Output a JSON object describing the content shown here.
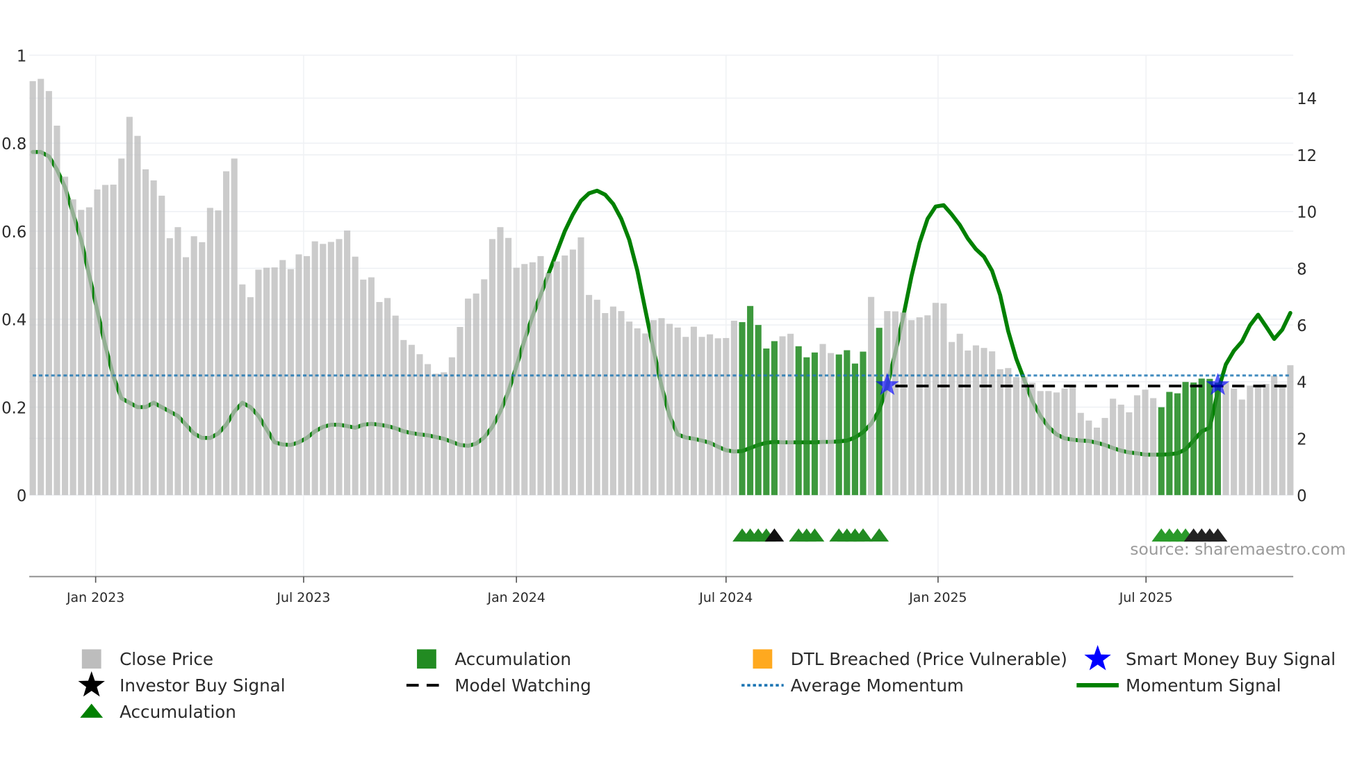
{
  "chart_data": {
    "type": "bar",
    "title": "",
    "source": "source: sharemaestro.com",
    "left_axis": {
      "range": [
        0,
        1
      ],
      "ticks": [
        "0",
        "0.2",
        "0.4",
        "0.6",
        "0.8",
        "1"
      ],
      "tick_values": [
        0,
        0.2,
        0.4,
        0.6,
        0.8,
        1
      ]
    },
    "right_axis": {
      "range": [
        0,
        14
      ],
      "ticks": [
        "0",
        "2",
        "4",
        "6",
        "8",
        "10",
        "12",
        "14"
      ],
      "tick_values": [
        0,
        2,
        4,
        6,
        8,
        10,
        12,
        14
      ]
    },
    "x_axis": {
      "unit": "weekly bar number (1 = first bar)",
      "ticks": [
        {
          "label": "Jan 2023",
          "bar": 8.8
        },
        {
          "label": "Jul 2023",
          "bar": 34.6
        },
        {
          "label": "Jan 2024",
          "bar": 61.0
        },
        {
          "label": "Jul 2024",
          "bar": 87.0
        },
        {
          "label": "Jan 2025",
          "bar": 113.3
        },
        {
          "label": "Jul 2025",
          "bar": 139.1
        }
      ]
    },
    "close_price": [
      14.6,
      14.68,
      14.25,
      13.03,
      11.23,
      10.43,
      10.06,
      10.15,
      10.78,
      10.94,
      10.95,
      11.87,
      13.34,
      12.67,
      11.49,
      11.1,
      10.56,
      9.06,
      9.45,
      8.39,
      9.13,
      8.92,
      10.13,
      10.04,
      11.42,
      11.87,
      7.43,
      6.98,
      7.95,
      8.02,
      8.03,
      8.29,
      7.97,
      8.49,
      8.43,
      8.95,
      8.86,
      8.93,
      9.03,
      9.33,
      8.41,
      7.6,
      7.68,
      6.81,
      6.95,
      6.33,
      5.47,
      5.3,
      4.97,
      4.62,
      4.28,
      4.33,
      4.86,
      5.93,
      6.93,
      7.11,
      7.61,
      9.03,
      9.45,
      9.07,
      8.02,
      8.15,
      8.21,
      8.43,
      7.83,
      8.24,
      8.45,
      8.66,
      9.09,
      7.06,
      6.89,
      6.42,
      6.65,
      6.49,
      6.12,
      5.88,
      5.7,
      6.17,
      6.24,
      6.04,
      5.91,
      5.58,
      5.94,
      5.58,
      5.67,
      5.53,
      5.54,
      6.15,
      6.1,
      6.67,
      6.0,
      5.17,
      5.43,
      5.6,
      5.69,
      5.25,
      4.86,
      5.03,
      5.33,
      5.01,
      4.96,
      5.11,
      4.64,
      5.06,
      6.99,
      5.9,
      6.49,
      6.48,
      6.44,
      6.17,
      6.27,
      6.34,
      6.78,
      6.76,
      5.4,
      5.69,
      5.1,
      5.28,
      5.19,
      5.07,
      4.44,
      4.48,
      4.16,
      4.16,
      3.96,
      3.67,
      3.67,
      3.62,
      3.76,
      3.83,
      2.9,
      2.63,
      2.38,
      2.72,
      3.4,
      3.19,
      2.92,
      3.52,
      3.72,
      3.42,
      3.1,
      3.64,
      3.59,
      3.99,
      3.97,
      4.11,
      4.1,
      3.97,
      3.99,
      3.76,
      3.37,
      3.86,
      3.83,
      3.92,
      4.21,
      3.86,
      4.58
    ],
    "accumulation_bars": [
      89,
      90,
      91,
      92,
      93,
      96,
      97,
      98,
      101,
      102,
      103,
      104,
      106,
      141,
      142,
      143,
      144,
      145,
      146,
      147,
      148
    ],
    "momentum_signal": [
      0.78,
      0.78,
      0.77,
      0.74,
      0.7,
      0.64,
      0.58,
      0.5,
      0.42,
      0.34,
      0.27,
      0.22,
      0.21,
      0.2,
      0.2,
      0.21,
      0.2,
      0.19,
      0.18,
      0.16,
      0.14,
      0.13,
      0.13,
      0.14,
      0.16,
      0.19,
      0.21,
      0.2,
      0.18,
      0.15,
      0.12,
      0.115,
      0.114,
      0.12,
      0.13,
      0.145,
      0.155,
      0.16,
      0.16,
      0.157,
      0.153,
      0.16,
      0.162,
      0.16,
      0.157,
      0.152,
      0.145,
      0.141,
      0.138,
      0.136,
      0.132,
      0.128,
      0.121,
      0.114,
      0.112,
      0.117,
      0.131,
      0.155,
      0.19,
      0.235,
      0.293,
      0.352,
      0.407,
      0.455,
      0.504,
      0.552,
      0.6,
      0.638,
      0.669,
      0.686,
      0.692,
      0.683,
      0.662,
      0.628,
      0.58,
      0.51,
      0.42,
      0.331,
      0.248,
      0.18,
      0.138,
      0.131,
      0.128,
      0.124,
      0.119,
      0.11,
      0.102,
      0.099,
      0.1,
      0.107,
      0.114,
      0.119,
      0.121,
      0.12,
      0.12,
      0.12,
      0.12,
      0.12,
      0.121,
      0.121,
      0.122,
      0.124,
      0.131,
      0.143,
      0.162,
      0.193,
      0.248,
      0.324,
      0.407,
      0.497,
      0.573,
      0.628,
      0.656,
      0.659,
      0.638,
      0.614,
      0.583,
      0.559,
      0.542,
      0.51,
      0.455,
      0.373,
      0.31,
      0.262,
      0.214,
      0.18,
      0.155,
      0.138,
      0.129,
      0.126,
      0.124,
      0.123,
      0.119,
      0.114,
      0.107,
      0.101,
      0.097,
      0.095,
      0.092,
      0.092,
      0.092,
      0.093,
      0.095,
      0.104,
      0.124,
      0.145,
      0.153,
      0.235,
      0.297,
      0.328,
      0.349,
      0.386,
      0.41,
      0.383,
      0.355,
      0.376,
      0.414
    ],
    "average_momentum": 0.272,
    "model_watching": {
      "value": 0.248,
      "from_bar": 108,
      "to_bar": 157
    },
    "smart_money_buy_signals": [
      {
        "bar": 107,
        "value": 0.25
      },
      {
        "bar": 148,
        "value": 0.25
      }
    ],
    "accumulation_markers": [
      {
        "bar": 89,
        "color": "#228b22"
      },
      {
        "bar": 90,
        "color": "#228b22"
      },
      {
        "bar": 91,
        "color": "#228b22"
      },
      {
        "bar": 92,
        "color": "#228b22"
      },
      {
        "bar": 93,
        "color": "#111111"
      },
      {
        "bar": 96,
        "color": "#228b22"
      },
      {
        "bar": 97,
        "color": "#228b22"
      },
      {
        "bar": 98,
        "color": "#228b22"
      },
      {
        "bar": 101,
        "color": "#228b22"
      },
      {
        "bar": 102,
        "color": "#228b22"
      },
      {
        "bar": 103,
        "color": "#228b22"
      },
      {
        "bar": 104,
        "color": "#228b22"
      },
      {
        "bar": 106,
        "color": "#228b22"
      },
      {
        "bar": 141,
        "color": "#2a9a2a"
      },
      {
        "bar": 142,
        "color": "#2a9a2a"
      },
      {
        "bar": 143,
        "color": "#2a9a2a"
      },
      {
        "bar": 144,
        "color": "#2a9a2a"
      },
      {
        "bar": 145,
        "color": "#222222"
      },
      {
        "bar": 146,
        "color": "#222222"
      },
      {
        "bar": 147,
        "color": "#222222"
      },
      {
        "bar": 148,
        "color": "#222222"
      }
    ],
    "colors": {
      "close_price": "#bdbdbd",
      "accumulation": "#228b22",
      "dtl_breached": "#ffa91f",
      "smart_money": "#0000ff",
      "investor": "#000000",
      "model_watching": "#000000",
      "average_momentum": "#1f77b4",
      "momentum": "#008000"
    },
    "legend": {
      "placement": "bottom",
      "items": [
        {
          "label": "Close Price",
          "symbol": "square",
          "color": "#bdbdbd"
        },
        {
          "label": "Accumulation",
          "symbol": "square",
          "color": "#228b22"
        },
        {
          "label": "DTL Breached (Price Vulnerable)",
          "symbol": "square",
          "color": "#ffa91f"
        },
        {
          "label": "Smart Money Buy Signal",
          "symbol": "star",
          "color": "#0000ff"
        },
        {
          "label": "Investor Buy Signal",
          "symbol": "star",
          "color": "#000000"
        },
        {
          "label": "Model Watching",
          "symbol": "dash",
          "color": "#000000"
        },
        {
          "label": "Average Momentum",
          "symbol": "dot",
          "color": "#1f77b4"
        },
        {
          "label": "Momentum Signal",
          "symbol": "line",
          "color": "#008000"
        },
        {
          "label": "Accumulation",
          "symbol": "triangle",
          "color": "#008000"
        }
      ]
    }
  }
}
